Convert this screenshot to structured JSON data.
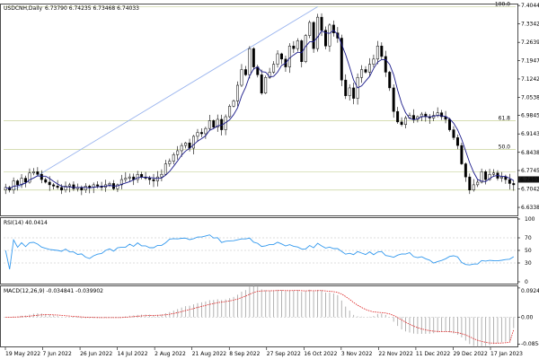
{
  "main_header": {
    "symbol": "USDCNH,Daily",
    "values": "6.73790 6.74235 6.73468 6.74033"
  },
  "rsi_header": "RSI(14) 40.0414",
  "macd_header": "MACD(12,26,9) -0.034841 -0.039902",
  "colors": {
    "rsi_line": "#3399ee",
    "ma_line": "#1a1a8a",
    "trendline": "#9ab4ee",
    "fib": "#c8d29a",
    "macd_signal": "#dd2222",
    "histogram": "#aaaaaa",
    "price_tag_bg": "#1a1a1a"
  },
  "fib_labels": [
    "100.0",
    "61.8",
    "50.0"
  ],
  "chart_data": [
    {
      "type": "candlestick",
      "title": "USDCNH,Daily",
      "price_ticks": [
        7.40445,
        7.3342,
        7.26395,
        7.1947,
        7.1242,
        7.05385,
        6.98455,
        6.9143,
        6.84385,
        6.77455,
        6.7042,
        6.63385
      ],
      "current_price": 6.74033,
      "ylim": [
        6.61,
        7.405
      ],
      "x_labels": [
        "19 May 2022",
        "7 Jun 2022",
        "26 Jun 2022",
        "14 Jul 2022",
        "2 Aug 2022",
        "21 Aug 2022",
        "8 Sep 2022",
        "27 Sep 2022",
        "16 Oct 2022",
        "3 Nov 2022",
        "22 Nov 2022",
        "11 Dec 2022",
        "29 Dec 2022",
        "17 Jan 2023"
      ],
      "closes": [
        6.71,
        6.7,
        6.735,
        6.72,
        6.745,
        6.73,
        6.765,
        6.77,
        6.76,
        6.74,
        6.73,
        6.72,
        6.715,
        6.71,
        6.7,
        6.715,
        6.72,
        6.705,
        6.71,
        6.7,
        6.715,
        6.71,
        6.72,
        6.715,
        6.71,
        6.72,
        6.725,
        6.705,
        6.72,
        6.74,
        6.745,
        6.75,
        6.74,
        6.76,
        6.75,
        6.745,
        6.74,
        6.735,
        6.75,
        6.76,
        6.8,
        6.81,
        6.835,
        6.85,
        6.87,
        6.88,
        6.86,
        6.905,
        6.92,
        6.915,
        6.935,
        6.965,
        6.94,
        6.97,
        6.93,
        6.98,
        7.02,
        7.04,
        7.1,
        7.16,
        7.14,
        7.24,
        7.17,
        7.14,
        7.07,
        7.13,
        7.15,
        7.18,
        7.22,
        7.2,
        7.17,
        7.25,
        7.24,
        7.27,
        7.19,
        7.29,
        7.34,
        7.24,
        7.36,
        7.31,
        7.25,
        7.33,
        7.3,
        7.28,
        7.12,
        7.06,
        7.09,
        7.05,
        7.13,
        7.16,
        7.15,
        7.18,
        7.2,
        7.25,
        7.21,
        7.15,
        7.09,
        7.0,
        6.96,
        6.95,
        6.975,
        6.985,
        6.97,
        6.98,
        6.99,
        6.98,
        6.975,
        6.985,
        6.995,
        6.98,
        6.97,
        6.93,
        6.9,
        6.87,
        6.8,
        6.75,
        6.7,
        6.72,
        6.73,
        6.77,
        6.74,
        6.76,
        6.765,
        6.745,
        6.75,
        6.74,
        6.725,
        6.72
      ]
    },
    {
      "type": "line",
      "title": "RSI(14)",
      "ylim": [
        0,
        100
      ],
      "levels": [
        100,
        70,
        50,
        30,
        0
      ],
      "last_value": 40.0414
    },
    {
      "type": "bar",
      "title": "MACD(12,26,9)",
      "y_ticks": [
        0.092472,
        0.0,
        -0.085475
      ],
      "ylim": [
        -0.09,
        0.095
      ],
      "last_main": -0.034841,
      "last_signal": -0.039902
    }
  ]
}
